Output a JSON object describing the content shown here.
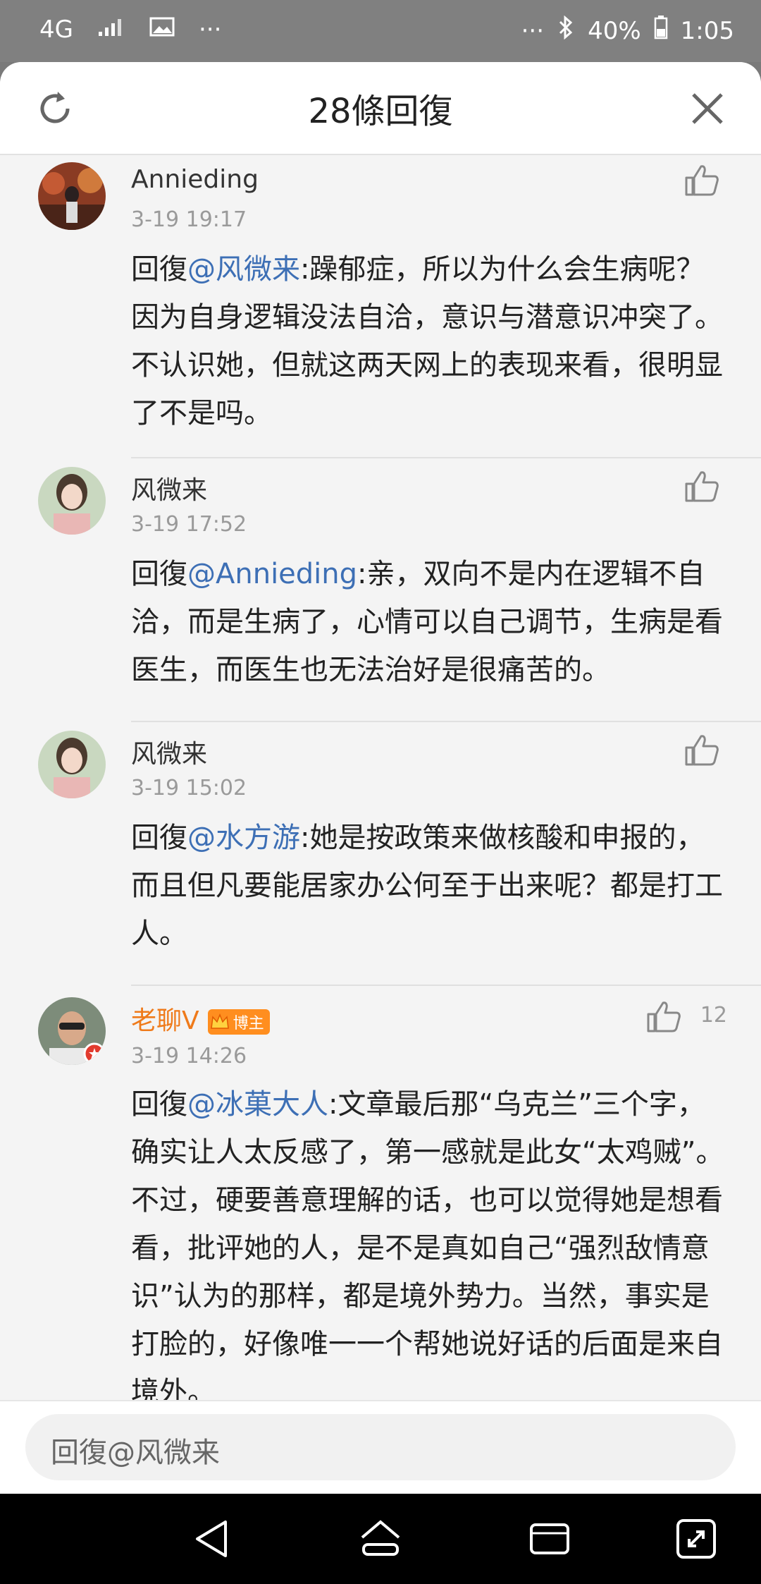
{
  "status_bar": {
    "network": "4G",
    "more_left": "···",
    "more_right": "···",
    "battery": "40%",
    "time": "1:05"
  },
  "sheet": {
    "title": "28條回復"
  },
  "comments": [
    {
      "author": "Annieding",
      "time": "3-19 19:17",
      "reply_prefix": "回復",
      "mention": "@风微来",
      "text": ":躁郁症，所以为什么会生病呢？因为自身逻辑没法自洽，意识与潜意识冲突了。不认识她，但就这两天网上的表现来看，很明显了不是吗。",
      "likes": ""
    },
    {
      "author": "风微来",
      "time": "3-19 17:52",
      "reply_prefix": "回復",
      "mention": "@Annieding",
      "text": ":亲，双向不是内在逻辑不自洽，而是生病了，心情可以自己调节，生病是看医生，而医生也无法治好是很痛苦的。",
      "likes": ""
    },
    {
      "author": "风微来",
      "time": "3-19 15:02",
      "reply_prefix": "回復",
      "mention": "@水方游",
      "text": ":她是按政策来做核酸和申报的，而且但凡要能居家办公何至于出来呢？都是打工人。",
      "likes": ""
    },
    {
      "author": "老聊V",
      "badge": "博主",
      "time": "3-19 14:26",
      "reply_prefix": "回復",
      "mention": "@冰菓大人",
      "text": ":文章最后那“乌克兰”三个字，确实让人太反感了，第一感就是此女“太鸡贼”。不过，硬要善意理解的话，也可以觉得她是想看看，批评她的人，是不是真如自己“强烈敌情意识”认为的那样，都是境外势力。当然，事实是打脸的，好像唯一一个帮她说好话的后面是来自境外。",
      "likes": "12"
    }
  ],
  "input": {
    "placeholder": "回復@风微来"
  },
  "colors": {
    "mention": "#3d6fb5",
    "vip_name": "#ef7a1a",
    "badge": "#ff8e1f"
  },
  "icons": [
    "signal-icon",
    "image-icon",
    "bluetooth-icon",
    "battery-icon",
    "refresh-icon",
    "close-icon",
    "thumbs-up-icon",
    "back-icon",
    "home-icon",
    "recents-icon",
    "rotate-icon"
  ]
}
